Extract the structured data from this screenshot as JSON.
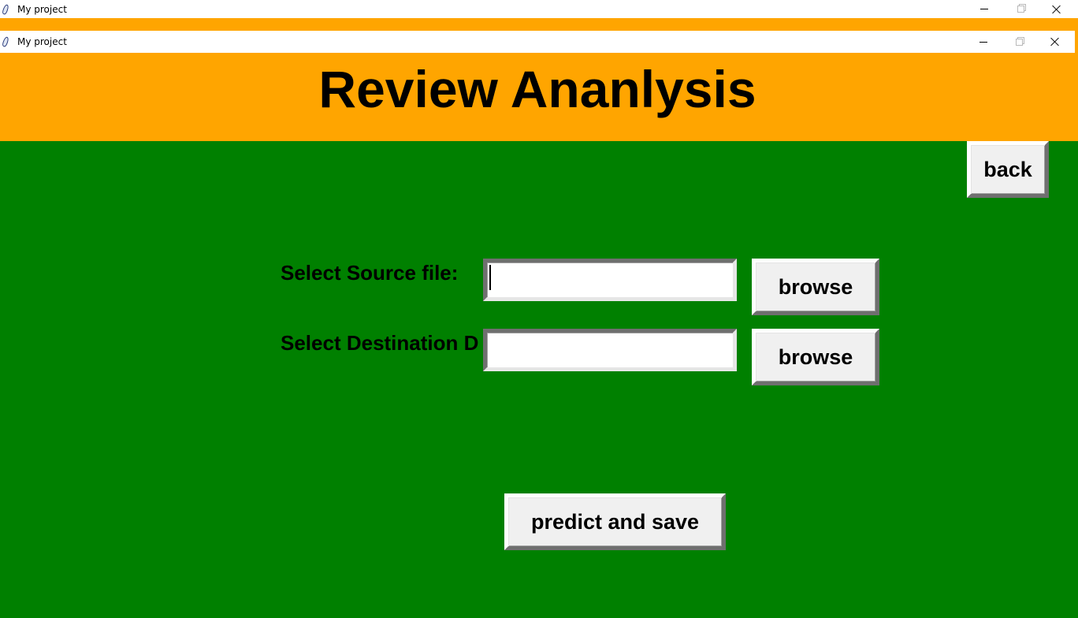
{
  "outer_window": {
    "title": "My project"
  },
  "inner_window": {
    "title": "My project"
  },
  "header": {
    "title": "Review Ananlysis"
  },
  "back_button": {
    "label": "back"
  },
  "source": {
    "label": "Select Source file:",
    "value": "",
    "browse_label": "browse"
  },
  "destination": {
    "label": "Select Destination D",
    "value": "",
    "browse_label": "browse"
  },
  "predict_button": {
    "label": "predict and save"
  },
  "colors": {
    "header_bg": "#ffa500",
    "body_bg": "#008000",
    "button_bg": "#f0f0f0"
  }
}
